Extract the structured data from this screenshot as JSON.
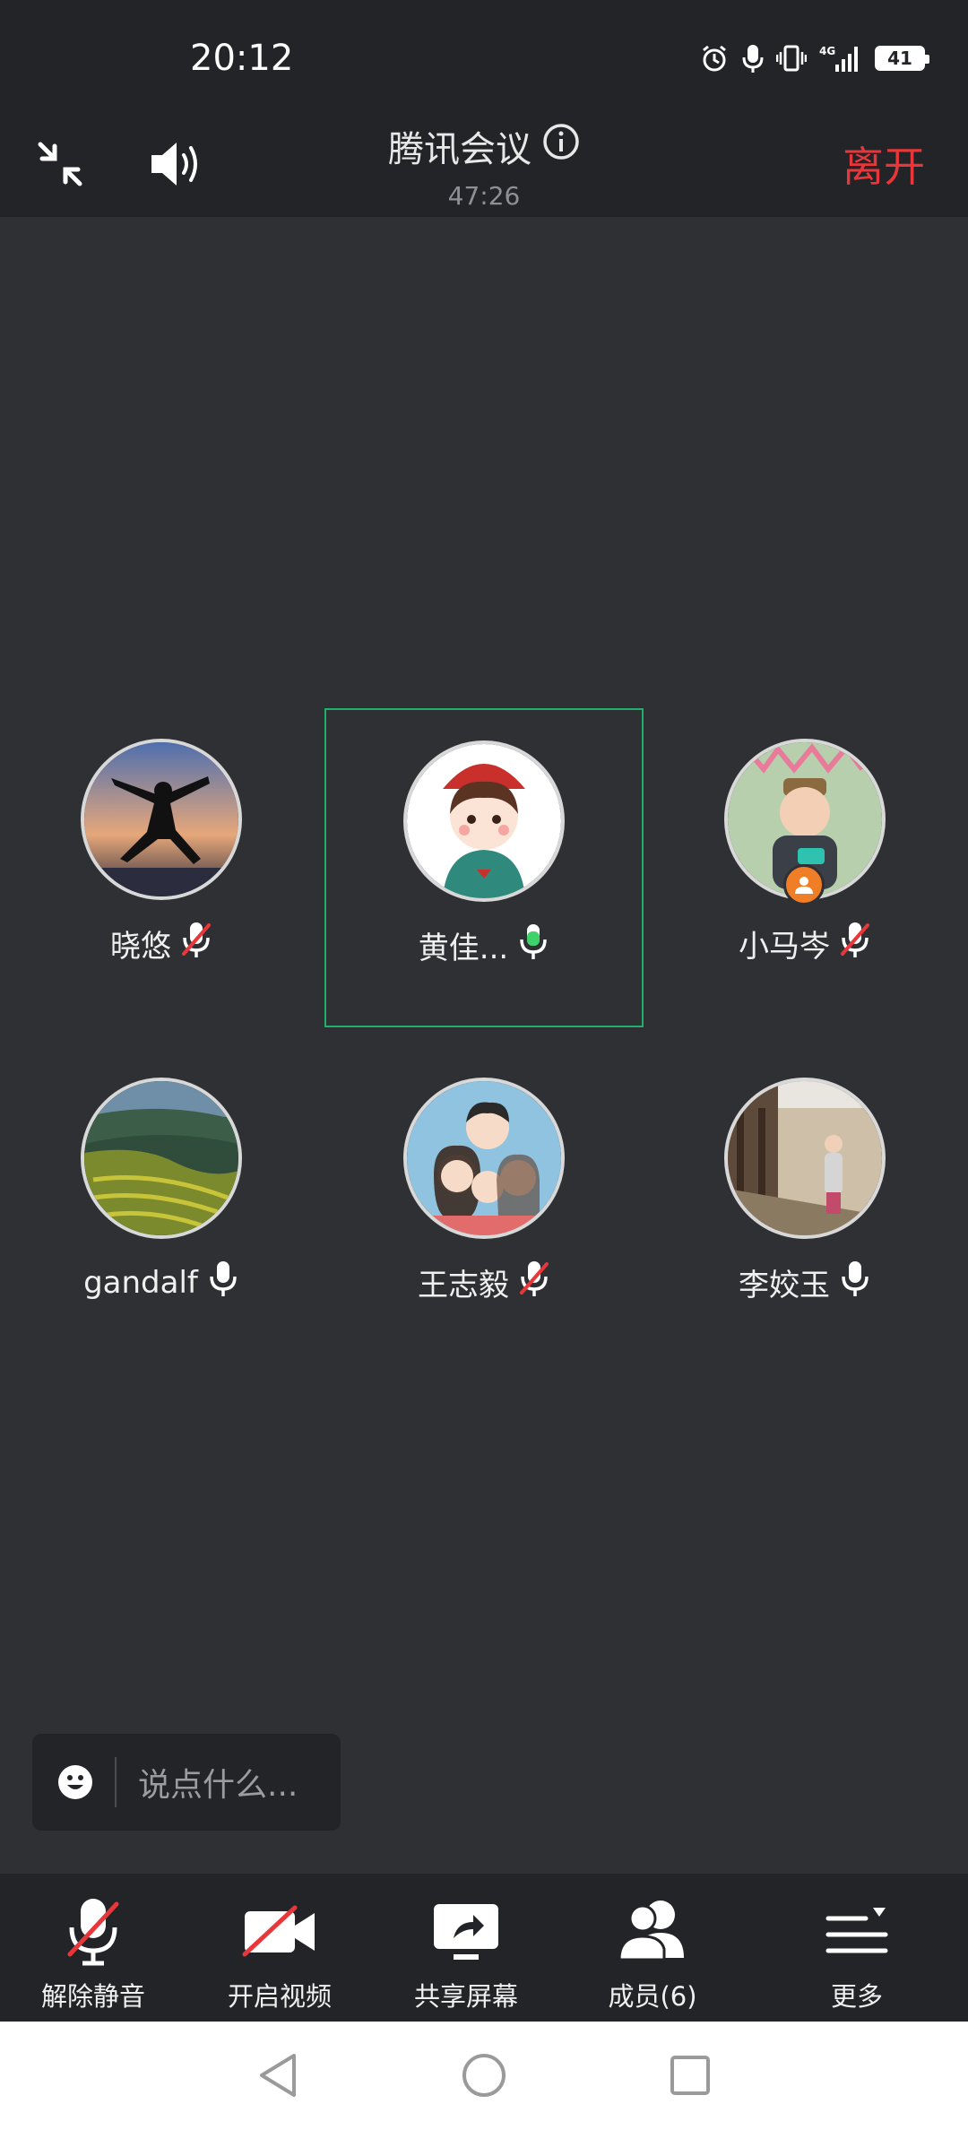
{
  "status_bar": {
    "time": "20:12",
    "battery": "41",
    "network": "4G",
    "icons": [
      "alarm-icon",
      "mic-icon",
      "vibrate-icon",
      "signal-icon",
      "battery-icon"
    ]
  },
  "header": {
    "title": "腾讯会议",
    "timer": "47:26",
    "leave_label": "离开",
    "leave_color": "#e8373a",
    "icons": [
      "minimize-icon",
      "speaker-icon",
      "info-icon"
    ]
  },
  "participants": [
    {
      "name": "晓悠",
      "mic": "muted",
      "avatar": "jump-silhouette"
    },
    {
      "name": "黄佳...",
      "mic": "speaking",
      "avatar": "cartoon-girl",
      "active": true
    },
    {
      "name": "小马岑",
      "mic": "muted",
      "avatar": "baby-photo",
      "host": true
    },
    {
      "name": "gandalf",
      "mic": "on",
      "avatar": "terrace-landscape"
    },
    {
      "name": "王志毅",
      "mic": "muted",
      "avatar": "family-cartoon"
    },
    {
      "name": "李姣玉",
      "mic": "on",
      "avatar": "corridor-photo"
    }
  ],
  "chat": {
    "placeholder": "说点什么..."
  },
  "toolbar": {
    "unmute_label": "解除静音",
    "video_label": "开启视频",
    "share_label": "共享屏幕",
    "members_label": "成员(6)",
    "more_label": "更多"
  },
  "colors": {
    "background": "#2e3034",
    "bar": "#222427",
    "active_border": "#21b06a",
    "muted_slash": "#e8373a",
    "speaking_green": "#3fd26b",
    "host_badge": "#f07e26"
  }
}
